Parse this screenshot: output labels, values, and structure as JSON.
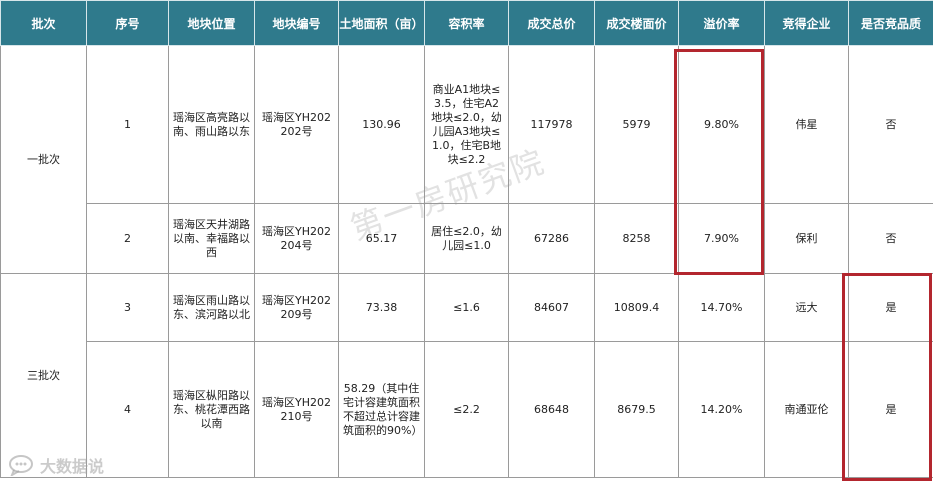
{
  "headers": [
    "批次",
    "序号",
    "地块位置",
    "地块编号",
    "土地面积（亩）",
    "容积率",
    "成交总价",
    "成交楼面价",
    "溢价率",
    "竞得企业",
    "是否竞品质"
  ],
  "groups": [
    {
      "batch": "一批次",
      "rows": [
        {
          "no": "1",
          "location": "瑶海区高亮路以南、雨山路以东",
          "code": "瑶海区YH202202号",
          "area": "130.96",
          "far": "商业A1地块≤3.5，住宅A2地块≤2.0，幼儿园A3地块≤1.0，住宅B地块≤2.2",
          "total": "117978",
          "floor_price": "5979",
          "premium": "9.80%",
          "company": "伟星",
          "quality": "否"
        },
        {
          "no": "2",
          "location": "瑶海区天井湖路以南、幸福路以西",
          "code": "瑶海区YH202204号",
          "area": "65.17",
          "far": "居住≤2.0，幼儿园≤1.0",
          "total": "67286",
          "floor_price": "8258",
          "premium": "7.90%",
          "company": "保利",
          "quality": "否"
        }
      ]
    },
    {
      "batch": "三批次",
      "rows": [
        {
          "no": "3",
          "location": "瑶海区雨山路以东、滨河路以北",
          "code": "瑶海区YH202209号",
          "area": "73.38",
          "far": "≤1.6",
          "total": "84607",
          "floor_price": "10809.4",
          "premium": "14.70%",
          "company": "远大",
          "quality": "是"
        },
        {
          "no": "4",
          "location": "瑶海区枞阳路以东、桃花潭西路以南",
          "code": "瑶海区YH202210号",
          "area": "58.29（其中住宅计容建筑面积不超过总计容建筑面积的90%）",
          "far": "≤2.2",
          "total": "68648",
          "floor_price": "8679.5",
          "premium": "14.20%",
          "company": "南通亚伦",
          "quality": "是"
        }
      ]
    }
  ],
  "watermark": "第一房研究院",
  "logo_text": "大数据说",
  "colors": {
    "header_bg": "#2f7a8c",
    "highlight": "#b3262e"
  }
}
